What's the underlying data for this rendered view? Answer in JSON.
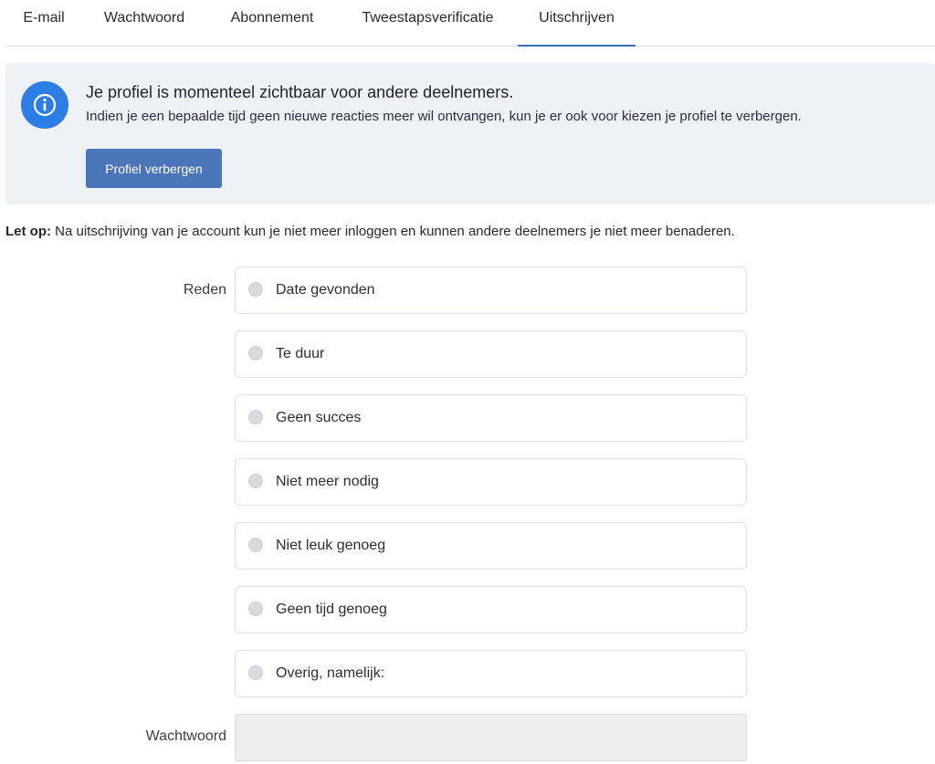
{
  "tabs": [
    {
      "label": "E-mail"
    },
    {
      "label": "Wachtwoord"
    },
    {
      "label": "Abonnement"
    },
    {
      "label": "Tweestapsverificatie"
    },
    {
      "label": "Uitschrijven"
    }
  ],
  "active_tab": "Uitschrijven",
  "info": {
    "title": "Je profiel is momenteel zichtbaar voor andere deelnemers.",
    "text": "Indien je een bepaalde tijd geen nieuwe reacties meer wil ontvangen, kun je er ook voor kiezen je profiel te verbergen.",
    "button_label": "Profiel verbergen",
    "icon": "info-icon"
  },
  "warning": {
    "label": "Let op:",
    "text": " Na uitschrijving van je account kun je niet meer inloggen en kunnen andere deelnemers je niet meer benaderen."
  },
  "form": {
    "reason_label": "Reden",
    "options": [
      {
        "label": "Date gevonden"
      },
      {
        "label": "Te duur"
      },
      {
        "label": "Geen succes"
      },
      {
        "label": "Niet meer nodig"
      },
      {
        "label": "Niet leuk genoeg"
      },
      {
        "label": "Geen tijd genoeg"
      },
      {
        "label": "Overig, namelijk:"
      }
    ],
    "password_label": "Wachtwoord",
    "password_value": ""
  },
  "colors": {
    "accent": "#3b6fb6",
    "button": "#4a75b8",
    "info_icon": "#2a7ee6",
    "panel": "#eef1f6"
  }
}
